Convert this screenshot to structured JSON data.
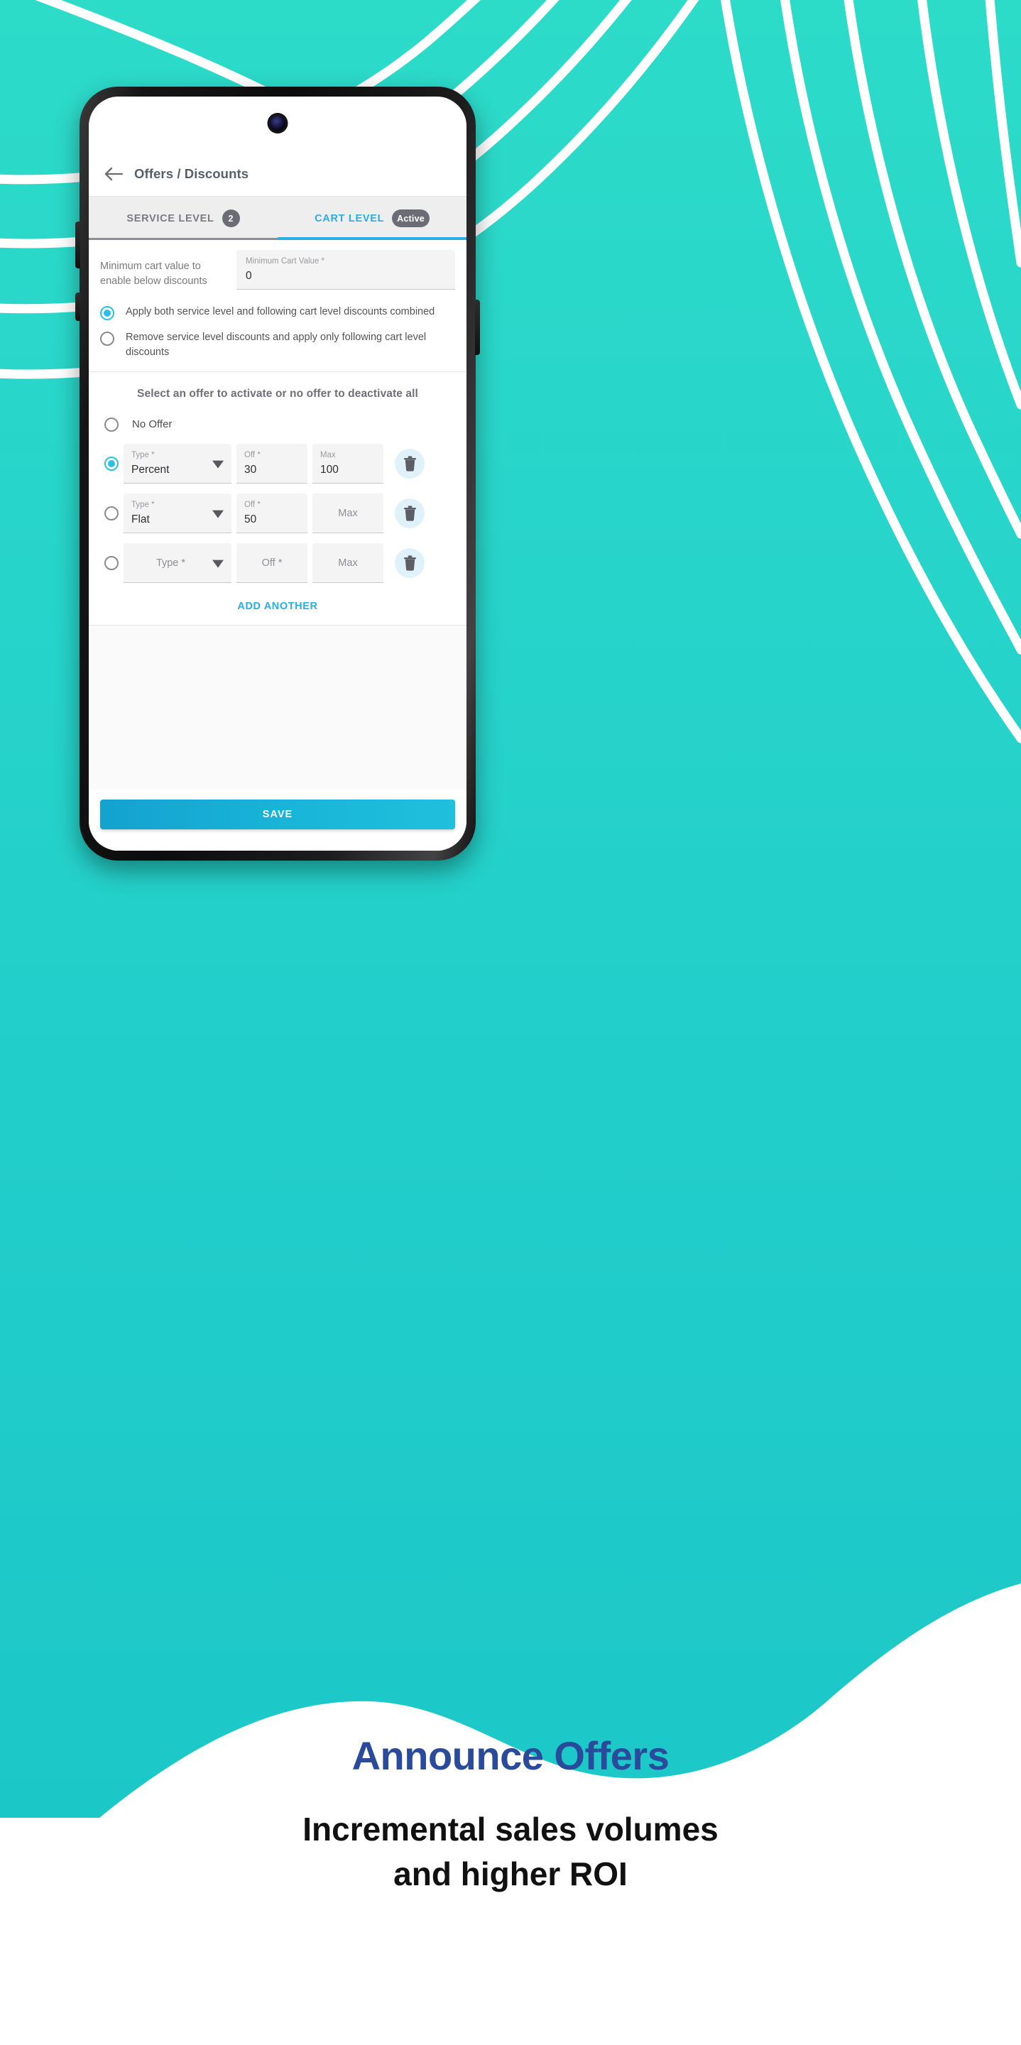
{
  "theme": {
    "teal": "#2ad6c6",
    "teal_deep": "#1ec8c4",
    "accent_blue": "#29ade4",
    "badge_grey": "#6c6c76",
    "promo_blue": "#2a4b9b"
  },
  "app": {
    "header": {
      "back_icon": "back-arrow-icon",
      "title": "Offers / Discounts"
    },
    "tabs": [
      {
        "label": "SERVICE LEVEL",
        "badge": "2",
        "active": false
      },
      {
        "label": "CART LEVEL",
        "badge": "Active",
        "active": true
      }
    ],
    "min_cart": {
      "description": "Minimum cart value to enable below discounts",
      "field_label": "Minimum Cart Value *",
      "field_value": "0"
    },
    "combine_options": [
      {
        "label": "Apply both service level and following cart level discounts combined",
        "selected": true
      },
      {
        "label": "Remove service level discounts and apply only following cart level discounts",
        "selected": false
      }
    ],
    "offers": {
      "heading": "Select an offer to activate or no offer to deactivate all",
      "no_offer_label": "No Offer",
      "no_offer_selected": false,
      "column_labels": {
        "type": "Type *",
        "off": "Off *",
        "max": "Max"
      },
      "rows": [
        {
          "selected": true,
          "type": "Percent",
          "off": "30",
          "max": "100",
          "delete_icon": "trash-icon"
        },
        {
          "selected": false,
          "type": "Flat",
          "off": "50",
          "max": "",
          "delete_icon": "trash-icon"
        },
        {
          "selected": false,
          "type": "",
          "off": "",
          "max": "",
          "delete_icon": "trash-icon"
        }
      ],
      "add_another_label": "ADD ANOTHER"
    },
    "save_label": "SAVE"
  },
  "promo": {
    "title": "Announce Offers",
    "subtitle_line1": "Incremental sales volumes",
    "subtitle_line2": "and higher ROI"
  }
}
